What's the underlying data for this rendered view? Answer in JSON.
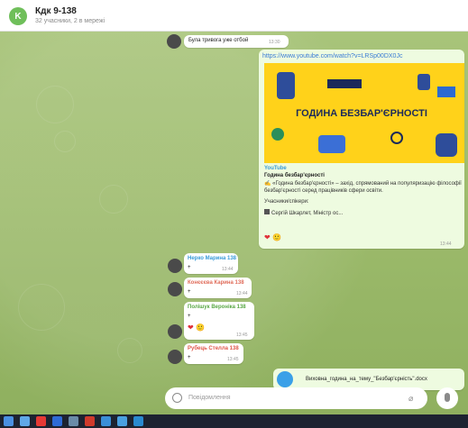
{
  "header": {
    "avatar_letter": "K",
    "title": "Кдк 9-138",
    "subtitle": "32 учасники, 2 в мережі"
  },
  "messages": [
    {
      "text": "Була тривога уже отбой",
      "time": "13:30"
    },
    {
      "link": "https://www.youtube.com/watch?v=LRSp00DX0Jc",
      "preview_banner": "ГОДИНА БЕЗБАР'ЄРНОСТІ",
      "site": "YouTube",
      "preview_title": "Година безбар'єрності",
      "preview_desc": "✍ «Година безбар'єрності» – захід, спрямований на популяризацію філософії безбар'єрності серед працівників сфери освіти.",
      "speakers_label": "Учасники/спікери:",
      "speaker_line": "Сергій Шкарлет, Міністр ос...",
      "reactions": [
        "❤",
        "🙂"
      ],
      "time": "13:44"
    }
  ],
  "replies": [
    {
      "name": "Нерко Марина 138",
      "name_color": "#3a9bd8",
      "text": "+",
      "time": "13:44"
    },
    {
      "name": "Конєєєва Карина 138",
      "name_color": "#e06c5a",
      "text": "+",
      "time": "13:44"
    },
    {
      "name": "Полішук Вероніка 138",
      "name_color": "#5aa846",
      "text": "+",
      "reactions": [
        "❤",
        "🙂"
      ],
      "time": "13:45"
    },
    {
      "name": "Рубець Стелла 138",
      "name_color": "#e0584a",
      "text": "+",
      "time": "13:45"
    }
  ],
  "file": {
    "name": "Виховна_година_на_тему_\"Безбар'єрність\".docx"
  },
  "composer": {
    "placeholder": "Повідомлення"
  },
  "colors": {
    "accent": "#6fbf5a",
    "link": "#3a7bd5",
    "taskbar": "#1d2331"
  }
}
